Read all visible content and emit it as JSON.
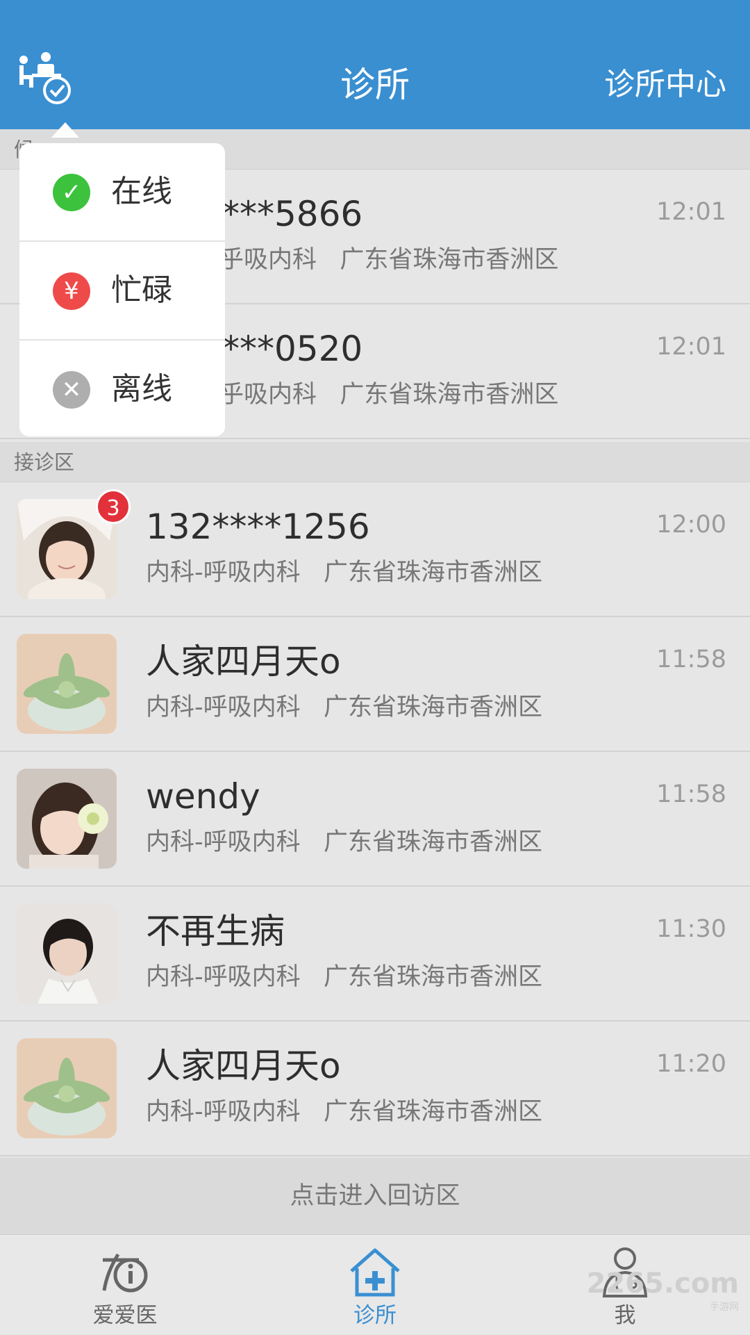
{
  "header": {
    "title": "诊所",
    "right_link": "诊所中心"
  },
  "sections": {
    "waiting_label": "候",
    "reception_label": "接诊区"
  },
  "waiting_rows": [
    {
      "name": "***5866",
      "meta": "乎吸内科   广东省珠海市香洲区",
      "time": "12:01"
    },
    {
      "name": "***0520",
      "meta": "乎吸内科   广东省珠海市香洲区",
      "time": "12:01"
    }
  ],
  "rows": [
    {
      "name": "132****1256",
      "meta": "内科-呼吸内科   广东省珠海市香洲区",
      "time": "12:00",
      "badge": "3",
      "avatar": "girl-with-hat"
    },
    {
      "name": "人家四月天o",
      "meta": "内科-呼吸内科   广东省珠海市香洲区",
      "time": "11:58",
      "avatar": "succulent"
    },
    {
      "name": "wendy",
      "meta": "内科-呼吸内科   广东省珠海市香洲区",
      "time": "11:58",
      "avatar": "girl-with-flower"
    },
    {
      "name": "不再生病",
      "meta": "内科-呼吸内科   广东省珠海市香洲区",
      "time": "11:30",
      "avatar": "young-man"
    },
    {
      "name": "人家四月天o",
      "meta": "内科-呼吸内科   广东省珠海市香洲区",
      "time": "11:20",
      "avatar": "succulent"
    }
  ],
  "revisit_label": "点击进入回访区",
  "status_menu": [
    {
      "label": "在线",
      "color": "#3cc23c",
      "glyph": "✓"
    },
    {
      "label": "忙碌",
      "color": "#ef4a4a",
      "glyph": "¥"
    },
    {
      "label": "离线",
      "color": "#aeaeae",
      "glyph": "✕"
    }
  ],
  "tabs": [
    {
      "label": "爱爱医",
      "icon": "aiaiyi-logo-icon"
    },
    {
      "label": "诊所",
      "icon": "clinic-house-icon",
      "active": true
    },
    {
      "label": "我",
      "icon": "doctor-profile-icon"
    }
  ],
  "watermark": {
    "brand": "2265",
    "suffix": ".com",
    "sub": "手游网"
  },
  "colors": {
    "accent": "#3a8fd1",
    "badge": "#e2313a"
  }
}
